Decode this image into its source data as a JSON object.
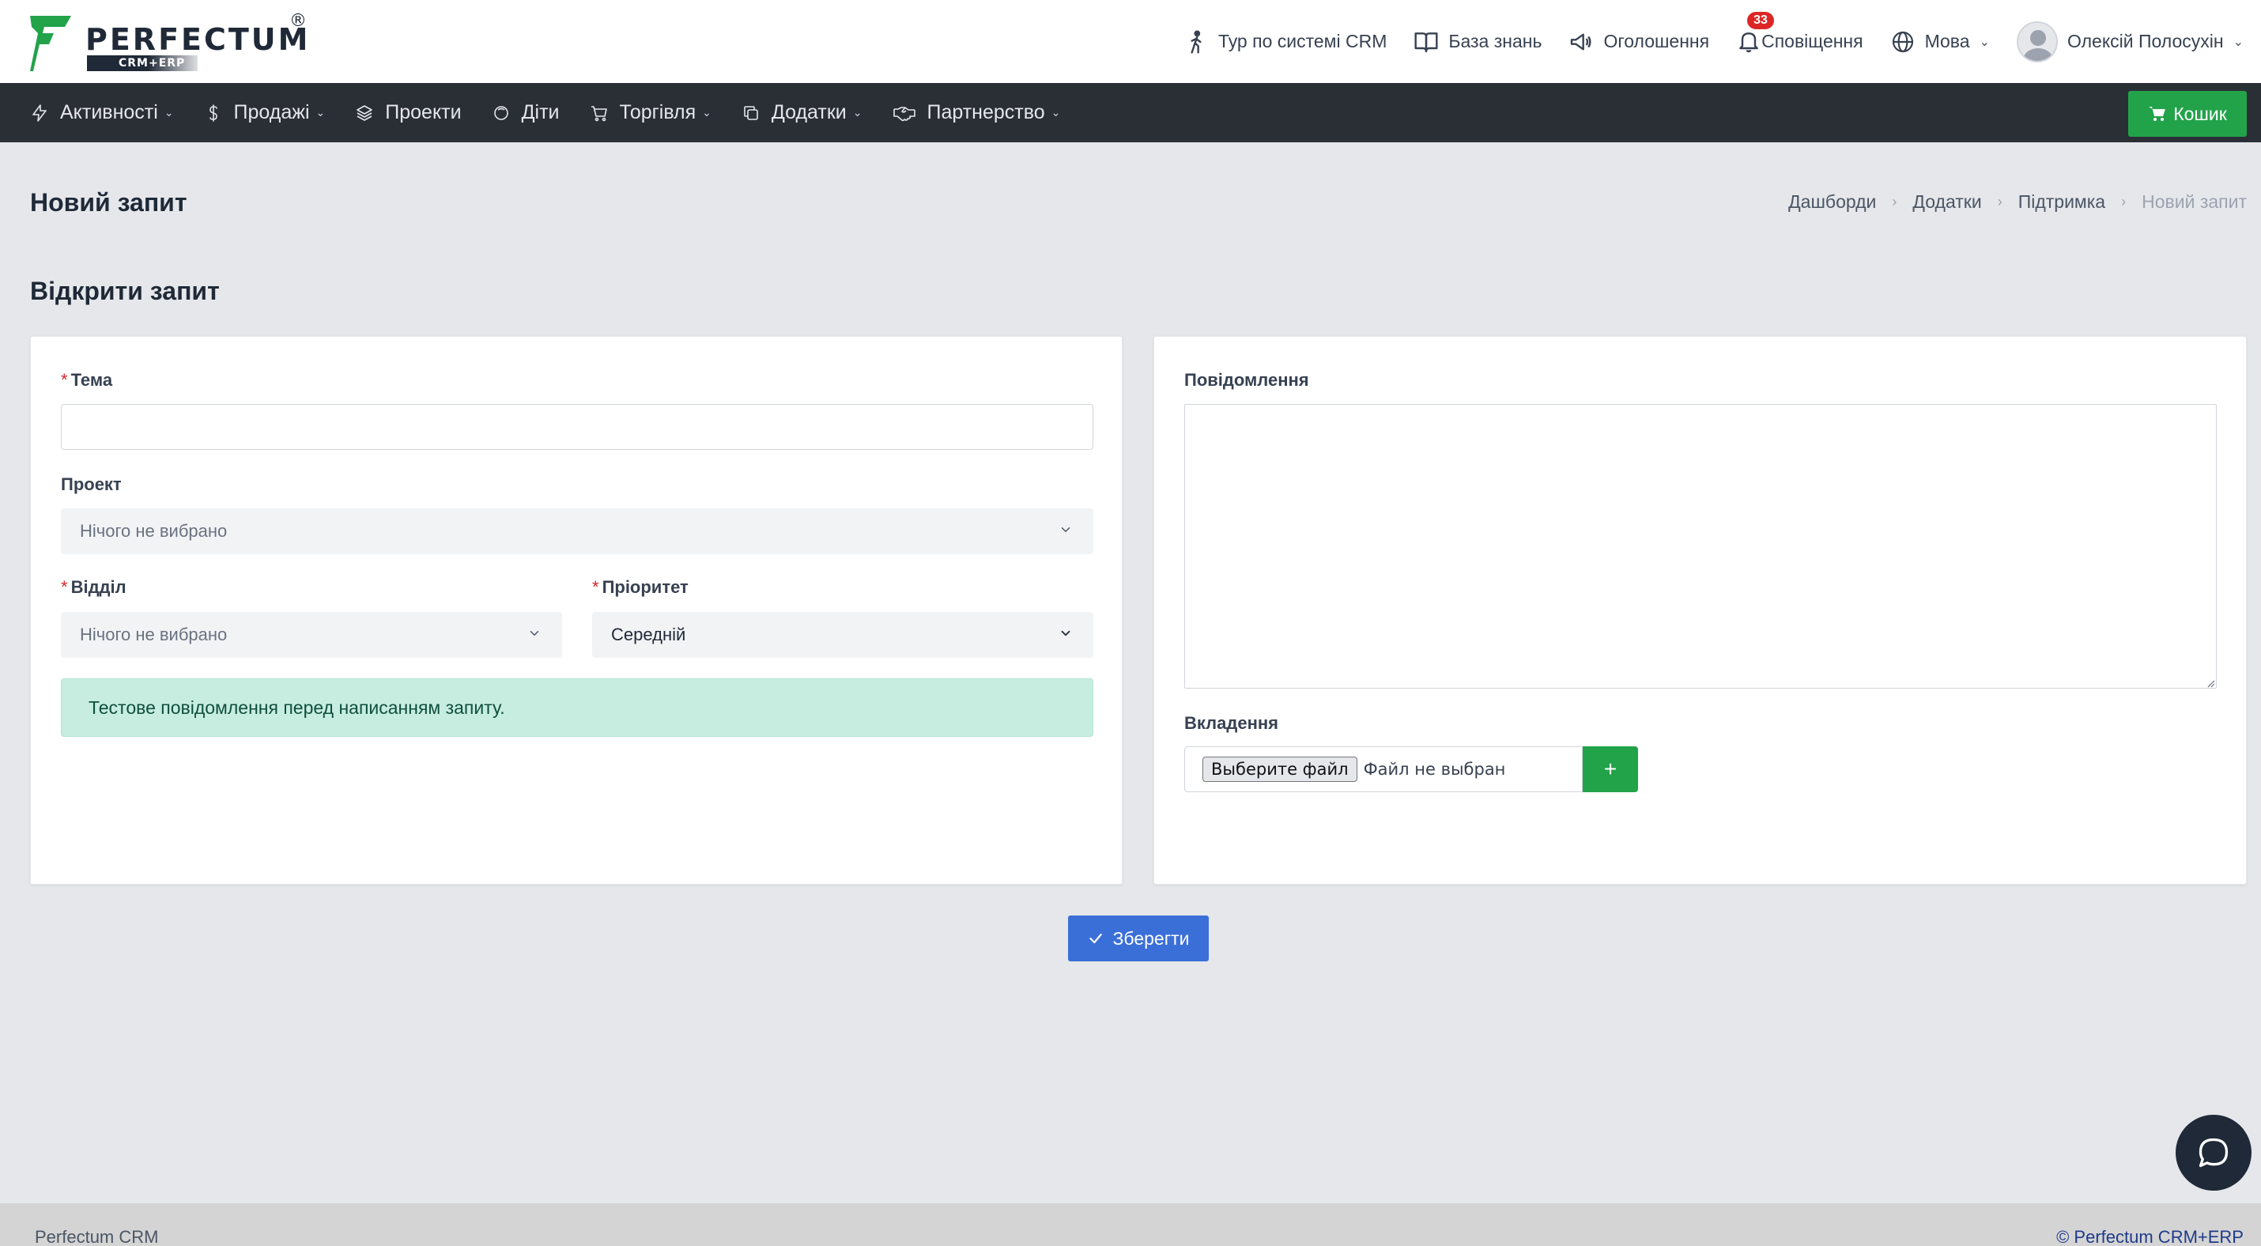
{
  "brand": {
    "name": "PERFECTUM",
    "registered": "®",
    "sub": "CRM+ERP",
    "accent": "#22a34a"
  },
  "topnav": {
    "tour": "Тур по системі CRM",
    "knowledge": "База знань",
    "announcements": "Оголошення",
    "notifications": "Сповіщення",
    "notifications_count": "33",
    "language": "Мова",
    "user": "Олексій Полосухін"
  },
  "menu": {
    "items": [
      {
        "label": "Активності",
        "icon": "bolt-icon",
        "dropdown": true
      },
      {
        "label": "Продажі",
        "icon": "dollar-icon",
        "dropdown": true
      },
      {
        "label": "Проекти",
        "icon": "layers-icon",
        "dropdown": false
      },
      {
        "label": "Діти",
        "icon": "face-icon",
        "dropdown": false
      },
      {
        "label": "Торгівля",
        "icon": "cart-icon",
        "dropdown": true
      },
      {
        "label": "Додатки",
        "icon": "copy-icon",
        "dropdown": true
      },
      {
        "label": "Партнерство",
        "icon": "handshake-icon",
        "dropdown": true
      }
    ],
    "cart": "Кошик"
  },
  "page": {
    "title": "Новий запит",
    "breadcrumb": [
      "Дашборди",
      "Додатки",
      "Підтримка",
      "Новий запит"
    ],
    "section": "Відкрити запит"
  },
  "form": {
    "subject_label": "Тема",
    "subject_value": "",
    "project_label": "Проект",
    "project_value": "Нічого не вибрано",
    "department_label": "Відділ",
    "department_value": "Нічого не вибрано",
    "priority_label": "Пріоритет",
    "priority_value": "Середній",
    "required_mark": "*",
    "alert": "Тестове повідомлення перед написанням запиту.",
    "message_label": "Повідомлення",
    "message_value": "",
    "attachments_label": "Вкладення",
    "file_button": "Выберите файл",
    "file_none": "Файл не выбран",
    "add_button": "+",
    "save_button": "Зберегти"
  },
  "footer": {
    "left": "Perfectum CRM",
    "right": "© Perfectum CRM+ERP"
  }
}
